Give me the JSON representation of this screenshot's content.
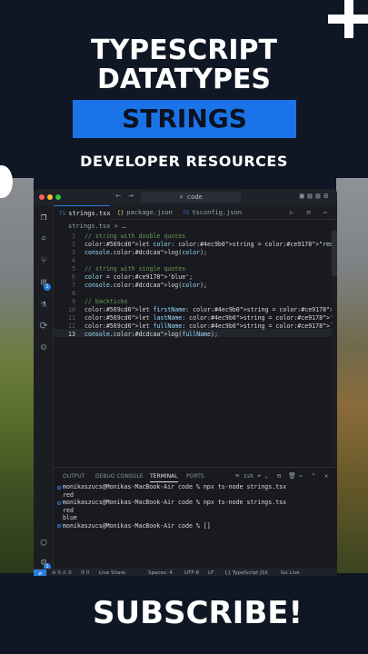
{
  "header": {
    "line1": "TYPESCRIPT",
    "line2": "DATATYPES",
    "banner": "STRINGS",
    "subtitle": "DEVELOPER RESOURCES"
  },
  "editor": {
    "window": {
      "search_text": "code",
      "nav_back": "←",
      "nav_forward": "→"
    },
    "tabs": [
      {
        "label": "strings.tsx",
        "icon": "TS",
        "icon_color": "#3178c6",
        "active": true
      },
      {
        "label": "package.json",
        "icon": "{}",
        "icon_color": "#e5c07b",
        "active": false
      },
      {
        "label": "tsconfig.json",
        "icon": "TS",
        "icon_color": "#3178c6",
        "active": false
      }
    ],
    "breadcrumb": "strings.tsx >  …",
    "line_numbers": [
      "1",
      "2",
      "3",
      "4",
      "5",
      "6",
      "7",
      "8",
      "9",
      "10",
      "11",
      "12",
      "13"
    ],
    "code_lines": [
      "// string with double quotes",
      "let color: string = \"red\";",
      "console.log(color);",
      "",
      "// string with single quotes",
      "color = 'blue';",
      "console.log(color);",
      "",
      "// backticks",
      "let firstName: string = 'Developer'; // single quotes",
      "let lastName: string = '<Resources'; // single quotes",
      "let fullName: string = `${firstName} ${lastName}`; // backticks",
      "console.log(fullName);"
    ],
    "activity_badges": [
      "1",
      "1"
    ],
    "panel": {
      "tabs": [
        "OUTPUT",
        "DEBUG CONSOLE",
        "TERMINAL",
        "PORTS"
      ],
      "active_tab": "TERMINAL",
      "shell": "zsh",
      "terminal_lines": [
        "monikaszucs@Monikas-MacBook-Air code % npx ts-node strings.tsx",
        "red",
        "",
        "monikaszucs@Monikas-MacBook-Air code % npx ts-node strings.tsx",
        "red",
        "blue",
        "monikaszucs@Monikas-MacBook-Air code % []"
      ]
    },
    "statusbar": {
      "problems": "⊘ 0 ⚠ 0",
      "ports": "⚲ 0",
      "live_share": "Live Share",
      "spaces": "Spaces: 4",
      "encoding": "UTF-8",
      "eol": "LF",
      "language": "{} TypeScript JSX",
      "golive": "Go Live"
    },
    "colors": {
      "accent": "#2a7de1",
      "comment": "#6a9955",
      "keyword": "#569cd6",
      "string": "#ce9178",
      "function": "#dcdcaa",
      "variable": "#9cdcfe",
      "type": "#4ec9b0"
    }
  },
  "footer": {
    "subscribe": "SUBSCRIBE!"
  }
}
